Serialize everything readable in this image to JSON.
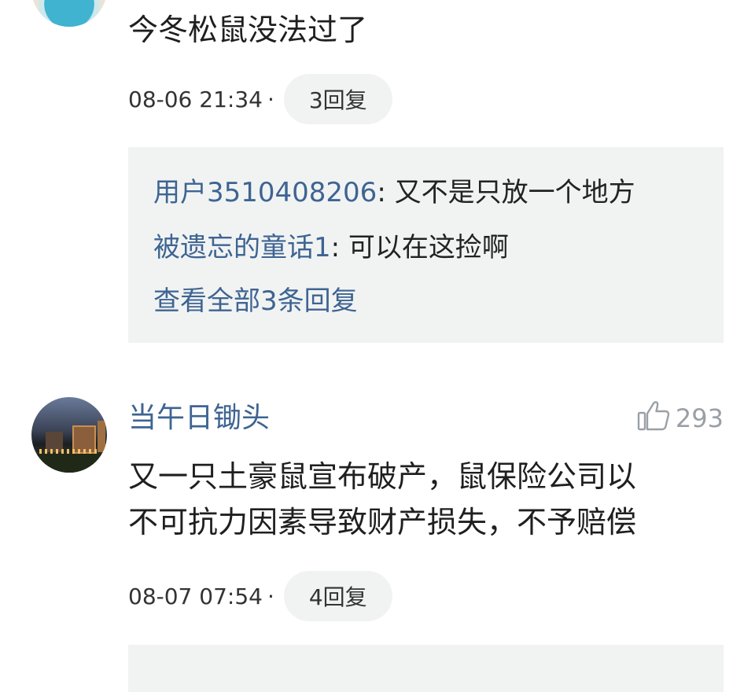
{
  "comments": [
    {
      "text": "今冬松鼠没法过了",
      "time": "08-06 21:34",
      "dot": "·",
      "reply_count": "3回复",
      "replies": [
        {
          "user": "用户3510408206",
          "sep": ":",
          "content": " 又不是只放一个地方"
        },
        {
          "user": "被遗忘的童话1",
          "sep": ":",
          "content": " 可以在这捡啊"
        }
      ],
      "view_all": "查看全部3条回复"
    },
    {
      "username": "当午日锄头",
      "likes": "293",
      "text_lines": [
        "又一只土豪鼠宣布破产，鼠保险公司以",
        "不可抗力因素导致财产损失，不予赔偿"
      ],
      "time": "08-07 07:54",
      "dot": "·",
      "reply_count": "4回复"
    }
  ],
  "icons": {
    "like": "thumbs-up-icon"
  },
  "colors": {
    "link": "#3e6492",
    "reply_bg": "#f1f3f3",
    "pill_bg": "#f1f2f2",
    "like": "#9aa0a6"
  }
}
